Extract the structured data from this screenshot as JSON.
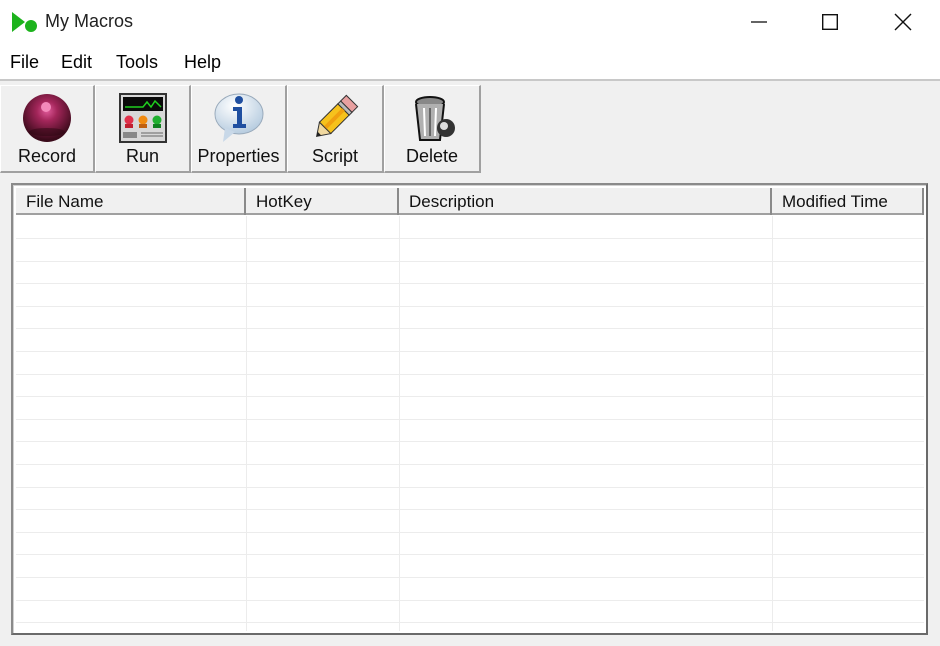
{
  "window": {
    "title": "My Macros",
    "controls": [
      "minimize",
      "maximize",
      "close"
    ]
  },
  "menu": {
    "items": [
      {
        "label": "File"
      },
      {
        "label": "Edit"
      },
      {
        "label": "Tools"
      },
      {
        "label": "Help"
      }
    ]
  },
  "toolbar": {
    "buttons": [
      {
        "label": "Record",
        "icon": "record-icon"
      },
      {
        "label": "Run",
        "icon": "run-icon"
      },
      {
        "label": "Properties",
        "icon": "info-icon"
      },
      {
        "label": "Script",
        "icon": "pencil-icon"
      },
      {
        "label": "Delete",
        "icon": "trash-icon"
      }
    ]
  },
  "table": {
    "columns": [
      "File Name",
      "HotKey",
      "Description",
      "Modified Time"
    ],
    "rows": []
  }
}
